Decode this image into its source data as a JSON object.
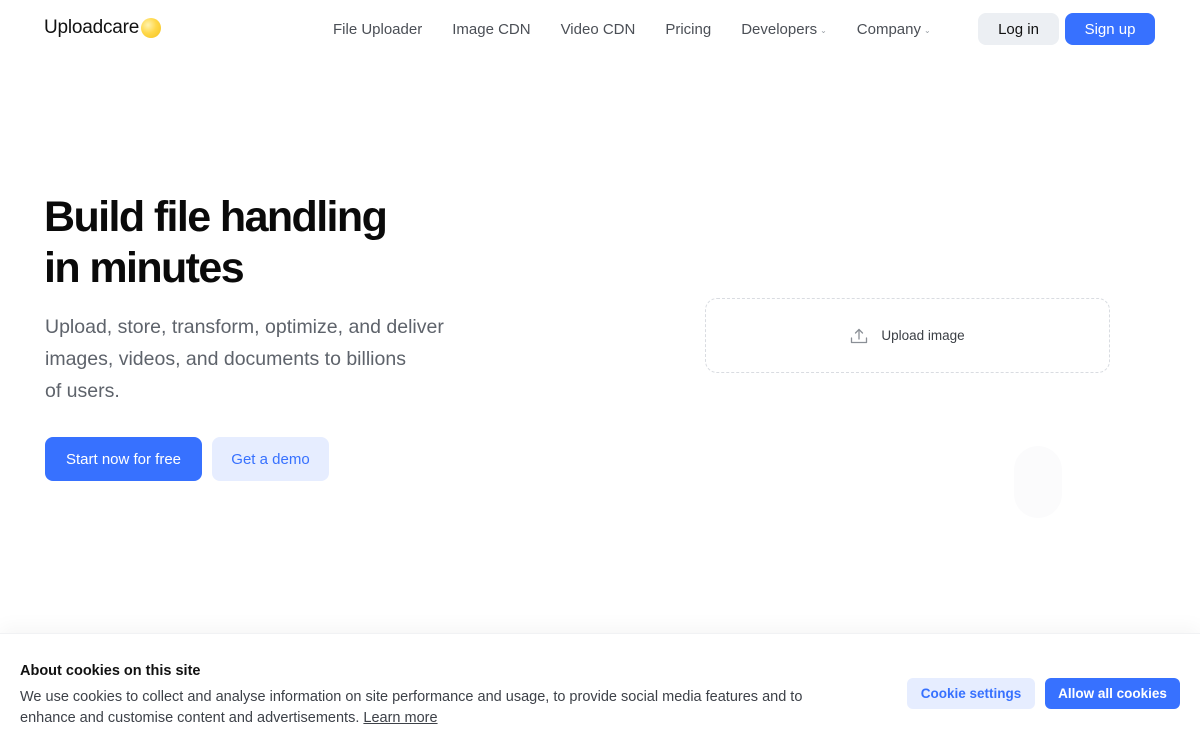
{
  "header": {
    "logo_text": "Uploadcare",
    "nav": [
      {
        "label": "File Uploader"
      },
      {
        "label": "Image CDN"
      },
      {
        "label": "Video CDN"
      },
      {
        "label": "Pricing"
      },
      {
        "label": "Developers",
        "dropdown": true
      },
      {
        "label": "Company",
        "dropdown": true
      }
    ],
    "login_label": "Log in",
    "signup_label": "Sign up"
  },
  "hero": {
    "title_line1": "Build file handling",
    "title_line2": "in minutes",
    "subtitle_line1": "Upload, store, transform, optimize, and deliver",
    "subtitle_line2": "images, videos, and documents to billions",
    "subtitle_line3": "of users.",
    "cta_primary": "Start now for free",
    "cta_secondary": "Get a demo"
  },
  "upload_widget": {
    "label": "Upload image",
    "icon": "upload-icon"
  },
  "cookie_banner": {
    "title": "About cookies on this site",
    "text": "We use cookies to collect and analyse information on site performance and usage, to provide social media features and to enhance and customise content and advertisements.",
    "learn_more": "Learn more",
    "settings_label": "Cookie settings",
    "allow_label": "Allow all cookies"
  },
  "colors": {
    "accent": "#3771ff",
    "accent_light": "#e6edff",
    "logo_dot": "#ffd84a",
    "text_muted": "#5e636b"
  }
}
